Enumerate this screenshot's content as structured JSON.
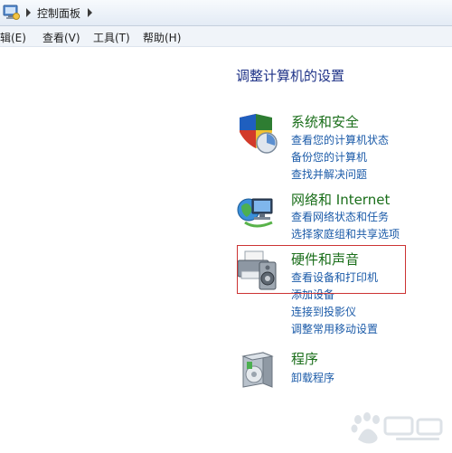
{
  "address_bar": {
    "breadcrumb": "控制面板"
  },
  "menu": {
    "items": [
      "编辑(E)",
      "查看(V)",
      "工具(T)",
      "帮助(H)"
    ]
  },
  "main": {
    "heading": "调整计算机的设置",
    "categories": [
      {
        "title": "系统和安全",
        "icon": "shield-icon",
        "links": [
          "查看您的计算机状态",
          "备份您的计算机",
          "查找并解决问题"
        ]
      },
      {
        "title": "网络和 Internet",
        "icon": "network-globe-icon",
        "links": [
          "查看网络状态和任务",
          "选择家庭组和共享选项"
        ]
      },
      {
        "title": "硬件和声音",
        "icon": "printer-speaker-icon",
        "links": [
          "查看设备和打印机",
          "添加设备",
          "连接到投影仪",
          "调整常用移动设置"
        ]
      },
      {
        "title": "程序",
        "icon": "programs-box-icon",
        "links": [
          "卸载程序"
        ]
      }
    ]
  },
  "colors": {
    "heading": "#1e3287",
    "category_title": "#1a6e1a",
    "link": "#1a5aa8",
    "highlight_box": "#cc3333"
  }
}
